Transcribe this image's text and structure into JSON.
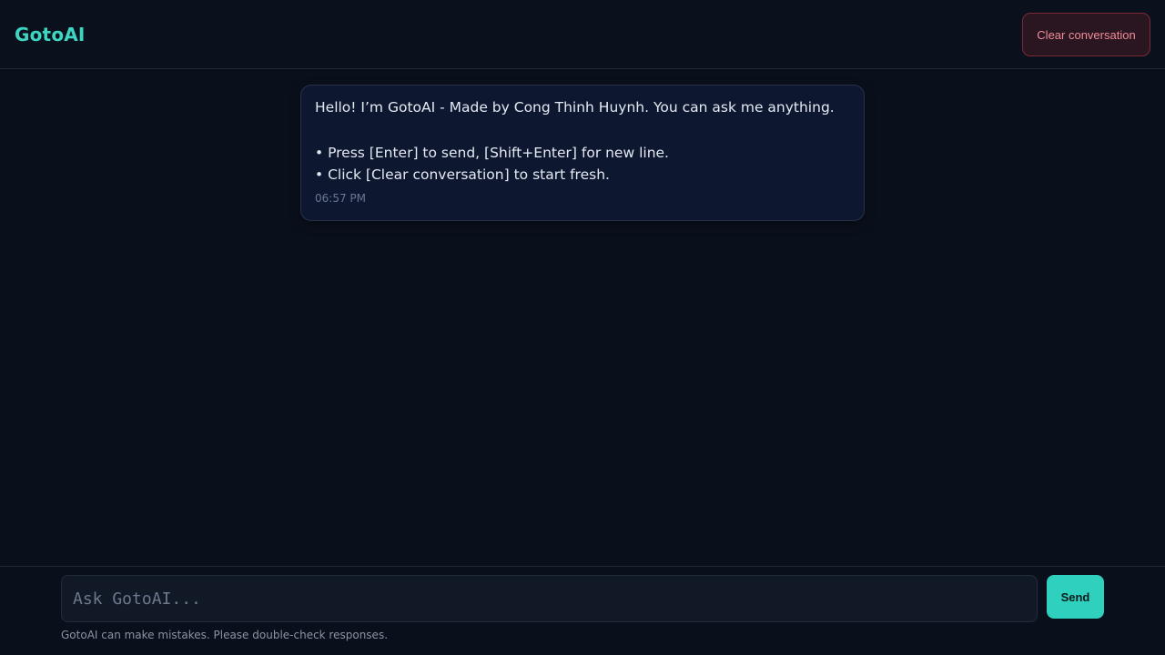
{
  "header": {
    "brand": "GotoAI",
    "clear_label": "Clear conversation"
  },
  "messages": [
    {
      "role": "assistant",
      "lines": [
        "Hello! I’m GotoAI - Made by Cong Thinh Huynh. You can ask me anything.",
        "",
        "• Press [Enter] to send, [Shift+Enter] for new line.",
        "• Click [Clear conversation] to start fresh."
      ],
      "time": "06:57 PM"
    }
  ],
  "composer": {
    "placeholder": "Ask GotoAI...",
    "value": "",
    "send_label": "Send",
    "disclaimer": "GotoAI can make mistakes. Please double-check responses."
  },
  "colors": {
    "accent": "#3dd6c3",
    "background": "#0a101b",
    "danger_text": "#f08c98"
  }
}
